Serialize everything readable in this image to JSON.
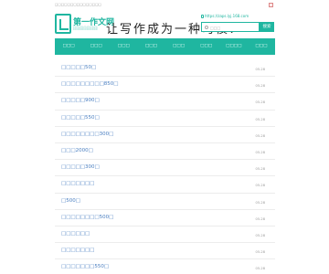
{
  "topbar": {
    "note": "□□□□□□□□□□□□□□□"
  },
  "brand": {
    "logo_name": "第一作文网",
    "logo_sub": "░░░░░░░░░░",
    "slogan": "让写作成为一种习惯!",
    "url": "https://zaps.lyj.168.com"
  },
  "search": {
    "placeholder": "□□□",
    "button_label": "搜索"
  },
  "nav": {
    "items": [
      "□□□",
      "□□□",
      "□□□",
      "□□□",
      "□□□",
      "□□□",
      "□□□□",
      "□□□"
    ]
  },
  "list": {
    "items": [
      {
        "title": "□□□□□50□",
        "date": "05-28"
      },
      {
        "title": "□□□□□□□□□850□",
        "date": "05-28"
      },
      {
        "title": "□□□□□900□",
        "date": "05-28"
      },
      {
        "title": "□□□□□550□",
        "date": "05-28"
      },
      {
        "title": "□□□□□□□□300□",
        "date": "05-28"
      },
      {
        "title": "□□□2000□",
        "date": "05-28"
      },
      {
        "title": "□□□□□300□",
        "date": "05-28"
      },
      {
        "title": "□□□□□□□",
        "date": "05-28"
      },
      {
        "title": "□500□",
        "date": "05-28"
      },
      {
        "title": "□□□□□□□□500□",
        "date": "05-28"
      },
      {
        "title": "□□□□□□",
        "date": "05-28"
      },
      {
        "title": "□□□□□□□",
        "date": "05-28"
      },
      {
        "title": "□□□□□□□550□",
        "date": "05-28"
      }
    ]
  }
}
